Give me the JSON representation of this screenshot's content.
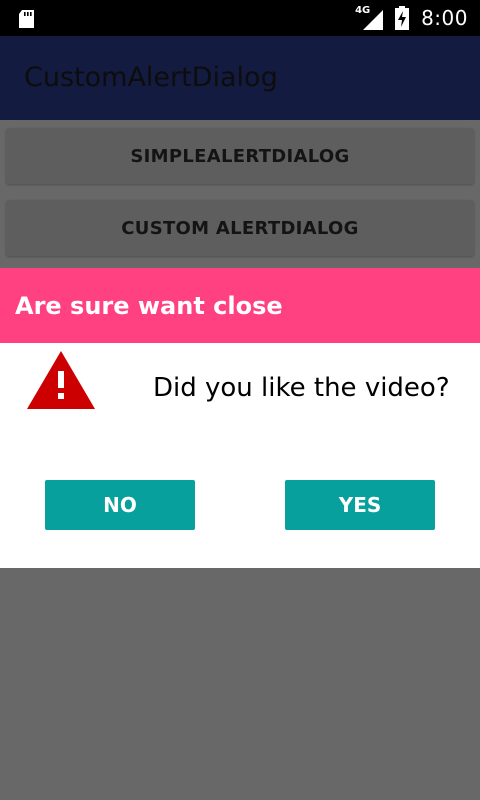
{
  "status_bar": {
    "network": "4G",
    "time": "8:00",
    "icons": [
      "sd-card-icon",
      "signal-icon",
      "battery-charging-icon"
    ]
  },
  "app_bar": {
    "title": "CustomAlertDialog",
    "color": "#141b40"
  },
  "buttons": {
    "simple_alert": "SIMPLEALERTDIALOG",
    "custom_alert": "CUSTOM ALERTDIALOG"
  },
  "dialog": {
    "title": "Are sure want close",
    "message": "Did you like the video?",
    "icon": "warning-icon",
    "no_label": "NO",
    "yes_label": "YES",
    "header_color": "#ff4081",
    "button_color": "#07a09c",
    "icon_color": "#cc0000"
  }
}
